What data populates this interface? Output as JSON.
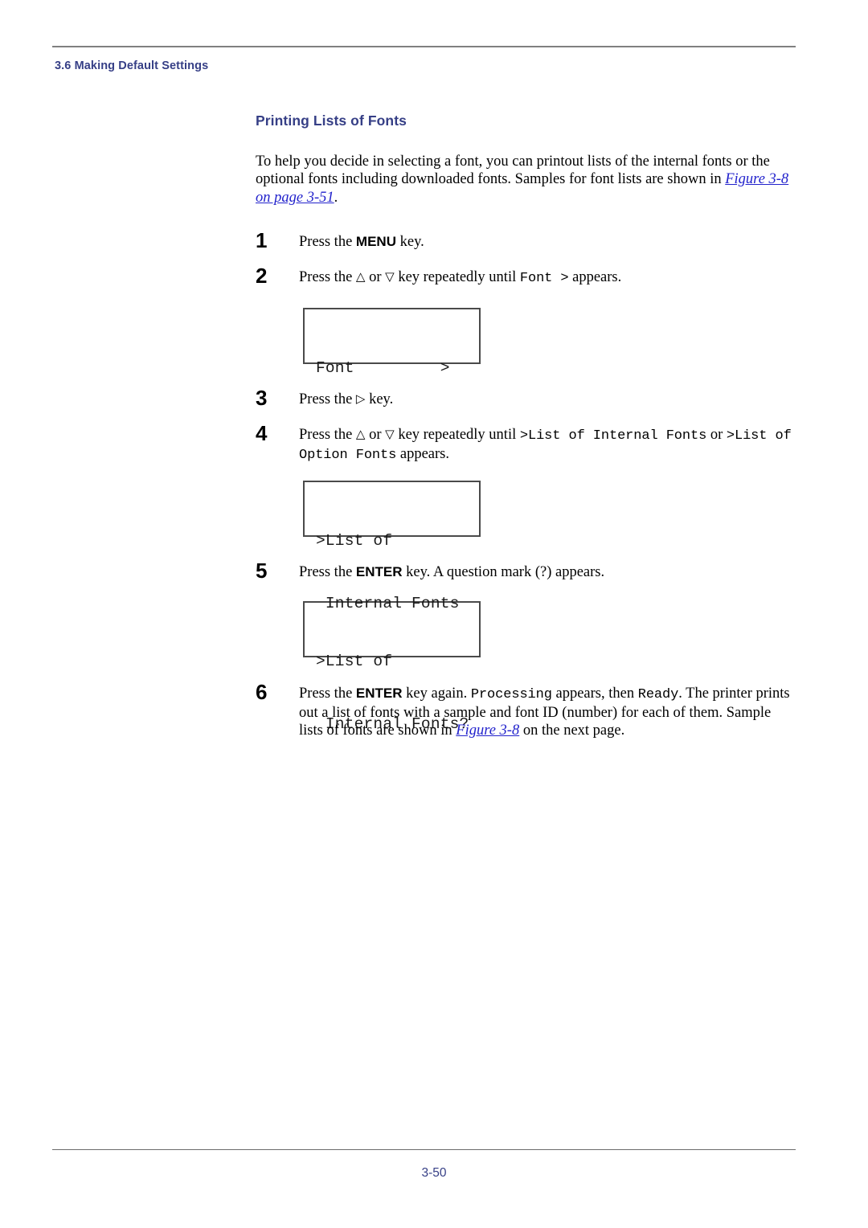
{
  "document": {
    "running_header": "3.6 Making Default Settings",
    "page_number": "3-50"
  },
  "section": {
    "title": "Printing Lists of Fonts",
    "intro_part1": "To help you decide in selecting a font, you can printout lists of the internal fonts or the optional fonts including downloaded fonts. Samples for font lists are shown in ",
    "intro_link": "Figure 3-8 on page 3-51",
    "intro_part2": "."
  },
  "steps": [
    {
      "number": "1",
      "pre": "Press the ",
      "kbd": "MENU",
      "post": " key."
    },
    {
      "number": "2",
      "pre": "Press the ",
      "up_arrow": "△",
      "mid": " or ",
      "down_arrow": "▽",
      "post": " key repeatedly until ",
      "mono": "Font >",
      "tail": " appears."
    },
    {
      "number": "3",
      "pre": "Press the ",
      "right_arrow": "▷",
      "post": " key."
    },
    {
      "number": "4",
      "pre": "Press the ",
      "up_arrow": "△",
      "mid": " or ",
      "down_arrow": "▽",
      "post": " key repeatedly until ",
      "mono1": ">List of Internal Fonts",
      "conj": " or ",
      "mono2": ">List of Option Fonts",
      "tail": " appears."
    },
    {
      "number": "5",
      "pre": "Press the ",
      "kbd": "ENTER",
      "post": " key. A question mark (?) appears."
    },
    {
      "number": "6",
      "pre": "Press the ",
      "kbd": "ENTER",
      "post": " key again. ",
      "mono1": "Processing",
      "mid1": " appears, then ",
      "mono2": "Ready",
      "mid2": ". The printer prints out a list of fonts with a sample and font ID (number) for each of them. Sample lists of fonts are shown in ",
      "link": "Figure 3-8",
      "tail": " on the next page."
    }
  ],
  "lcd_panels": [
    {
      "id": "font-menu",
      "line1": "Font         >",
      "line2": ""
    },
    {
      "id": "list-internal-fonts",
      "line1": ">List of",
      "line2": " Internal Fonts"
    },
    {
      "id": "list-internal-fonts-confirm",
      "line1": ">List of",
      "line2": " Internal Fonts?"
    }
  ],
  "colors": {
    "heading": "#363f86",
    "link": "#2222cc",
    "rule": "#808080"
  }
}
